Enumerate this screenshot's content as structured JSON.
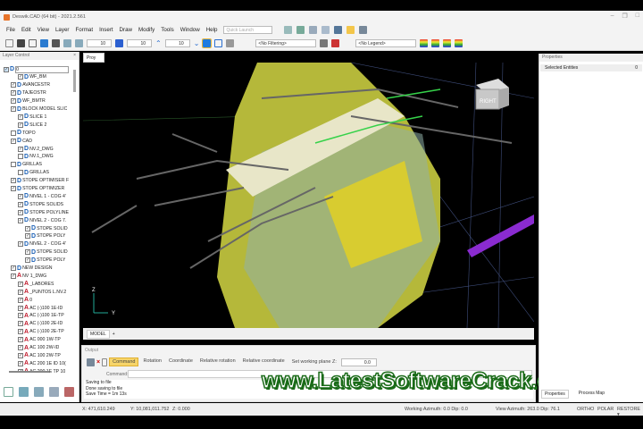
{
  "window": {
    "title": "Deswik.CAD (64 bit) - 2021.2.561"
  },
  "menu": [
    "File",
    "Edit",
    "View",
    "Layer",
    "Format",
    "Insert",
    "Draw",
    "Modify",
    "Tools",
    "Window",
    "Help"
  ],
  "quick_launch_placeholder": "Quick Launch",
  "toolbar": {
    "field1": "10",
    "field2": "10",
    "field3": "10",
    "filter": "<No Filtering>",
    "legend": "<No Legend>"
  },
  "layer_panel": {
    "title": "Layer Control",
    "rows": [
      {
        "label": "0",
        "lvl": 0,
        "icon": "d",
        "checked": true
      },
      {
        "label": "WF_BM",
        "lvl": 2,
        "icon": "d",
        "checked": true
      },
      {
        "label": "AVANCESTR",
        "lvl": 1,
        "icon": "d",
        "checked": true
      },
      {
        "label": "TAJEOSTR",
        "lvl": 1,
        "icon": "d",
        "checked": true
      },
      {
        "label": "WF_BMTR",
        "lvl": 1,
        "icon": "d",
        "checked": true
      },
      {
        "label": "BLOCK MODEL SLIC",
        "lvl": 1,
        "icon": "d",
        "checked": true
      },
      {
        "label": "SLICE 1",
        "lvl": 2,
        "icon": "d",
        "checked": true
      },
      {
        "label": "SLICE 2",
        "lvl": 2,
        "icon": "d",
        "checked": true
      },
      {
        "label": "TOPO",
        "lvl": 1,
        "icon": "d",
        "checked": false
      },
      {
        "label": "CAD",
        "lvl": 1,
        "icon": "d",
        "checked": true
      },
      {
        "label": "NV.2_DWG",
        "lvl": 2,
        "icon": "d",
        "checked": true
      },
      {
        "label": "NV.1_DWG",
        "lvl": 2,
        "icon": "d",
        "checked": false
      },
      {
        "label": "GRILLAS",
        "lvl": 1,
        "icon": "d",
        "checked": false
      },
      {
        "label": "GRILLAS",
        "lvl": 2,
        "icon": "d",
        "checked": false
      },
      {
        "label": "STOPE OPTIMISER F",
        "lvl": 1,
        "icon": "d",
        "checked": true
      },
      {
        "label": "STOPE OPTIMIZER",
        "lvl": 1,
        "icon": "d",
        "checked": true
      },
      {
        "label": "NIVEL 1 - COG 4'",
        "lvl": 2,
        "icon": "d",
        "checked": true
      },
      {
        "label": "STOPE SOLIDS",
        "lvl": 2,
        "icon": "d",
        "checked": true
      },
      {
        "label": "STOPE POLYLINE",
        "lvl": 2,
        "icon": "d",
        "checked": true
      },
      {
        "label": "NIVEL 2 - COG 7.",
        "lvl": 2,
        "icon": "d",
        "checked": true
      },
      {
        "label": "STOPE SOLID",
        "lvl": 3,
        "icon": "d",
        "checked": true
      },
      {
        "label": "STOPE POLY",
        "lvl": 3,
        "icon": "d",
        "checked": true
      },
      {
        "label": "NIVEL 2 - COG 4'",
        "lvl": 2,
        "icon": "d",
        "checked": true
      },
      {
        "label": "STOPE SOLID",
        "lvl": 3,
        "icon": "d",
        "checked": true
      },
      {
        "label": "STOPE POLY",
        "lvl": 3,
        "icon": "d",
        "checked": true
      },
      {
        "label": "NEW DESIGN",
        "lvl": 1,
        "icon": "d",
        "checked": true
      },
      {
        "label": "NV 1_DWG",
        "lvl": 1,
        "icon": "a",
        "checked": true
      },
      {
        "label": "_LABORES",
        "lvl": 2,
        "icon": "a",
        "checked": true
      },
      {
        "label": "_PUNTOS L.NV.2",
        "lvl": 2,
        "icon": "a",
        "checked": true
      },
      {
        "label": "0",
        "lvl": 2,
        "icon": "a",
        "checked": true
      },
      {
        "label": "AC (-)100 1E-ID",
        "lvl": 2,
        "icon": "a",
        "checked": true
      },
      {
        "label": "AC (-)100 1E-TP",
        "lvl": 2,
        "icon": "a",
        "checked": true
      },
      {
        "label": "AC (-)100 2E-ID",
        "lvl": 2,
        "icon": "a",
        "checked": true
      },
      {
        "label": "AC (-)100 2E-TP",
        "lvl": 2,
        "icon": "a",
        "checked": true
      },
      {
        "label": "AC 000 1W-TP",
        "lvl": 2,
        "icon": "a",
        "checked": true
      },
      {
        "label": "AC 100 2W-ID",
        "lvl": 2,
        "icon": "a",
        "checked": true
      },
      {
        "label": "AC 100 2W-TP",
        "lvl": 2,
        "icon": "a",
        "checked": true
      },
      {
        "label": "AC 200 1E ID 10(",
        "lvl": 2,
        "icon": "a",
        "checked": true
      },
      {
        "label": "AC 200 1E TP 10",
        "lvl": 2,
        "icon": "a",
        "checked": true
      }
    ]
  },
  "viewport": {
    "tab": "Proy",
    "model_tab": "MODEL",
    "add_tab": "+",
    "cube_label": "RIGHT",
    "axis_x": "Y",
    "axis_z": "Z"
  },
  "output": {
    "title": "Output",
    "buttons": [
      "Command",
      "Rotation",
      "Coordinate",
      "Relative rotation",
      "Relative coordinate"
    ],
    "plane_label": "Set working plane Z:",
    "plane_value": "0.0",
    "command_label": "Command:",
    "log": [
      "Saving to file",
      "Done saving to file",
      "Save Time = 1m 13s"
    ]
  },
  "properties": {
    "title": "Properties",
    "selected": "Selected Entities",
    "count": "0",
    "tabs": [
      "Properties",
      "Process Map"
    ]
  },
  "status": {
    "x": "X: 471,610.249",
    "y": "Y: 10,081,011.752",
    "z": "Z: 0.000",
    "working": "Working Azimuth: 0.0 Dip: 0.0",
    "view": "View Azimuth: 263.0 Dip: 76.1",
    "ortho": "ORTHO",
    "polar": "POLAR",
    "restore": "RESTORE ▾"
  },
  "watermark": "www.LatestSoftwareCrack.com"
}
